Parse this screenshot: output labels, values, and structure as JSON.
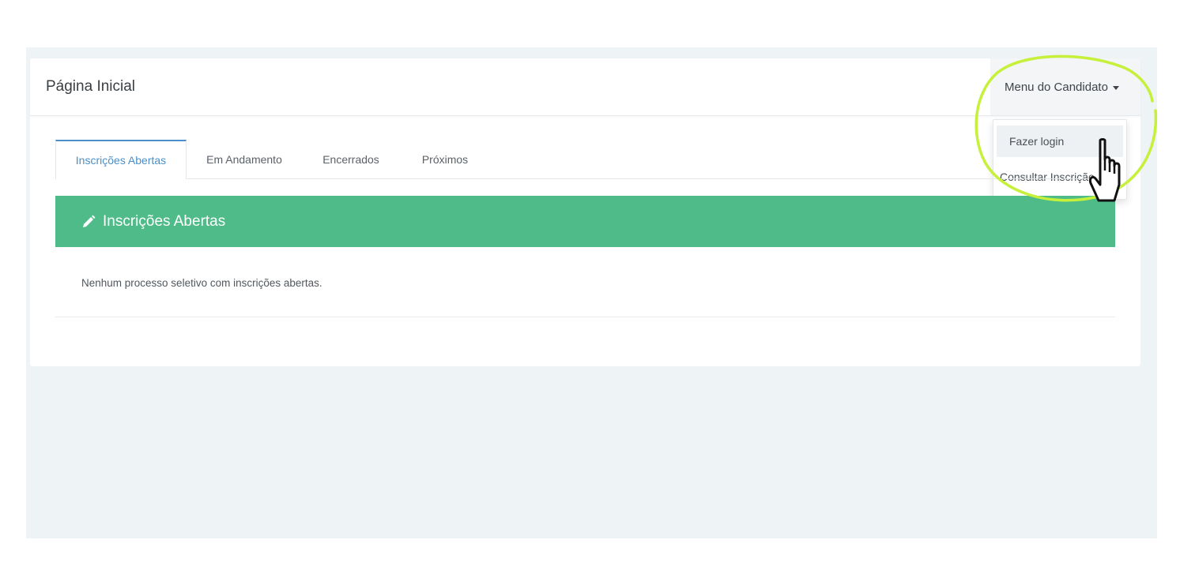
{
  "header": {
    "title": "Página Inicial",
    "candidate_menu_label": "Menu do Candidato"
  },
  "dropdown": {
    "items": [
      {
        "label": "Fazer login"
      },
      {
        "label": "Consultar Inscrição"
      }
    ]
  },
  "tabs": [
    {
      "label": "Inscrições Abertas",
      "active": true
    },
    {
      "label": "Em Andamento",
      "active": false
    },
    {
      "label": "Encerrados",
      "active": false
    },
    {
      "label": "Próximos",
      "active": false
    }
  ],
  "panel": {
    "title": "Inscrições Abertas",
    "icon": "pencil-icon",
    "empty_message": "Nenhum processo seletivo com inscrições abertas."
  },
  "colors": {
    "accent": "#4a8fc9",
    "panel_green": "#4fbb89",
    "highlight_circle": "#c6f03a"
  }
}
